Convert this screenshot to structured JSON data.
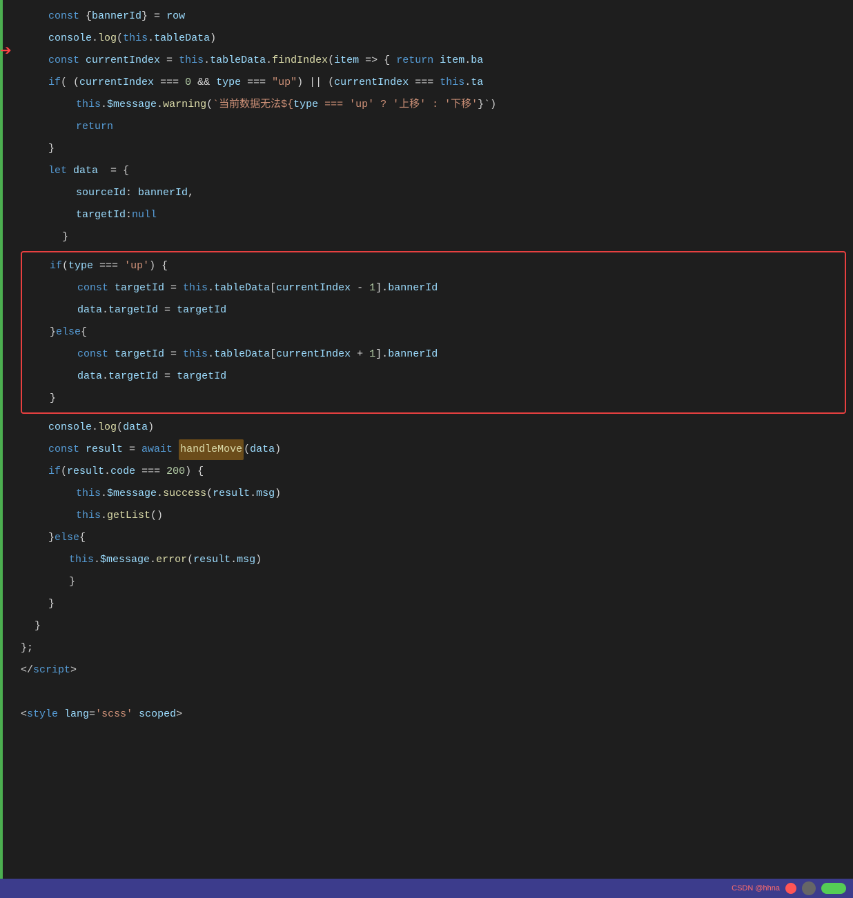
{
  "code": {
    "lines": [
      {
        "id": "line1",
        "indent": 2,
        "tokens": [
          {
            "type": "kw",
            "text": "const "
          },
          {
            "type": "punc",
            "text": "{"
          },
          {
            "type": "var",
            "text": "bannerId"
          },
          {
            "type": "punc",
            "text": "} = "
          },
          {
            "type": "var",
            "text": "row"
          }
        ]
      },
      {
        "id": "line2",
        "indent": 2,
        "tokens": [
          {
            "type": "var",
            "text": "console"
          },
          {
            "type": "punc",
            "text": "."
          },
          {
            "type": "fn",
            "text": "log"
          },
          {
            "type": "punc",
            "text": "("
          },
          {
            "type": "this-kw",
            "text": "this"
          },
          {
            "type": "punc",
            "text": "."
          },
          {
            "type": "var",
            "text": "tableData"
          },
          {
            "type": "punc",
            "text": ")"
          }
        ]
      },
      {
        "id": "line3",
        "indent": 2,
        "tokens": [
          {
            "type": "kw",
            "text": "const "
          },
          {
            "type": "var",
            "text": "currentIndex"
          },
          {
            "type": "punc",
            "text": " = "
          },
          {
            "type": "this-kw",
            "text": "this"
          },
          {
            "type": "punc",
            "text": "."
          },
          {
            "type": "var",
            "text": "tableData"
          },
          {
            "type": "punc",
            "text": "."
          },
          {
            "type": "fn",
            "text": "findIndex"
          },
          {
            "type": "punc",
            "text": "("
          },
          {
            "type": "var",
            "text": "item"
          },
          {
            "type": "punc",
            "text": " => { "
          },
          {
            "type": "kw",
            "text": "return "
          },
          {
            "type": "var",
            "text": "item"
          },
          {
            "type": "punc",
            "text": "."
          },
          {
            "type": "prop",
            "text": "ba"
          }
        ]
      },
      {
        "id": "line4",
        "indent": 2,
        "tokens": [
          {
            "type": "kw",
            "text": "if"
          },
          {
            "type": "punc",
            "text": "( ("
          },
          {
            "type": "var",
            "text": "currentIndex"
          },
          {
            "type": "punc",
            "text": " === "
          },
          {
            "type": "num",
            "text": "0"
          },
          {
            "type": "punc",
            "text": " && "
          },
          {
            "type": "var",
            "text": "type"
          },
          {
            "type": "punc",
            "text": " === "
          },
          {
            "type": "str",
            "text": "\"up\""
          },
          {
            "type": "punc",
            "text": ") || ("
          },
          {
            "type": "var",
            "text": "currentIndex"
          },
          {
            "type": "punc",
            "text": " === "
          },
          {
            "type": "this-kw",
            "text": "this"
          },
          {
            "type": "punc",
            "text": "."
          },
          {
            "type": "prop",
            "text": "ta"
          }
        ]
      },
      {
        "id": "line5",
        "indent": 4,
        "tokens": [
          {
            "type": "this-kw",
            "text": "this"
          },
          {
            "type": "punc",
            "text": "."
          },
          {
            "type": "prop",
            "text": "$message"
          },
          {
            "type": "punc",
            "text": "."
          },
          {
            "type": "fn",
            "text": "warning"
          },
          {
            "type": "punc",
            "text": "("
          },
          {
            "type": "template",
            "text": "`当前数据无法${"
          },
          {
            "type": "var",
            "text": "type"
          },
          {
            "type": "template",
            "text": " === 'up' ? '上移' : '下移'"
          },
          {
            "type": "punc",
            "text": "}`"
          }
        ]
      },
      {
        "id": "line6",
        "indent": 4,
        "tokens": [
          {
            "type": "kw",
            "text": "return"
          }
        ]
      },
      {
        "id": "line7",
        "indent": 2,
        "tokens": [
          {
            "type": "punc",
            "text": "}"
          }
        ]
      },
      {
        "id": "line8",
        "indent": 2,
        "tokens": [
          {
            "type": "kw",
            "text": "let "
          },
          {
            "type": "var",
            "text": "data"
          },
          {
            "type": "punc",
            "text": "  = {"
          }
        ]
      },
      {
        "id": "line9",
        "indent": 4,
        "tokens": [
          {
            "type": "prop",
            "text": "sourceId"
          },
          {
            "type": "punc",
            "text": ": "
          },
          {
            "type": "var",
            "text": "bannerId"
          },
          {
            "type": "punc",
            "text": ","
          }
        ]
      },
      {
        "id": "line10",
        "indent": 4,
        "tokens": [
          {
            "type": "prop",
            "text": "targetId"
          },
          {
            "type": "punc",
            "text": ":"
          },
          {
            "type": "kw",
            "text": "null"
          }
        ]
      },
      {
        "id": "line11",
        "indent": 2,
        "tokens": [
          {
            "type": "punc",
            "text": "  }"
          }
        ]
      },
      {
        "id": "highlighted_start",
        "is_box_start": true
      },
      {
        "id": "hline1",
        "indent": 2,
        "tokens": [
          {
            "type": "kw",
            "text": "if"
          },
          {
            "type": "punc",
            "text": "("
          },
          {
            "type": "var",
            "text": "type"
          },
          {
            "type": "punc",
            "text": " === "
          },
          {
            "type": "str",
            "text": "'up'"
          },
          {
            "type": "punc",
            "text": ") {"
          }
        ]
      },
      {
        "id": "hline2",
        "indent": 4,
        "tokens": [
          {
            "type": "kw",
            "text": "const "
          },
          {
            "type": "var",
            "text": "targetId"
          },
          {
            "type": "punc",
            "text": " = "
          },
          {
            "type": "this-kw",
            "text": "this"
          },
          {
            "type": "punc",
            "text": "."
          },
          {
            "type": "var",
            "text": "tableData"
          },
          {
            "type": "punc",
            "text": "["
          },
          {
            "type": "var",
            "text": "currentIndex"
          },
          {
            "type": "punc",
            "text": " - "
          },
          {
            "type": "num",
            "text": "1"
          },
          {
            "type": "punc",
            "text": "]."
          },
          {
            "type": "prop",
            "text": "bannerId"
          }
        ]
      },
      {
        "id": "hline3",
        "indent": 4,
        "tokens": [
          {
            "type": "var",
            "text": "data"
          },
          {
            "type": "punc",
            "text": "."
          },
          {
            "type": "prop",
            "text": "targetId"
          },
          {
            "type": "punc",
            "text": " = "
          },
          {
            "type": "var",
            "text": "targetId"
          }
        ]
      },
      {
        "id": "hline4",
        "indent": 2,
        "tokens": [
          {
            "type": "punc",
            "text": "}"
          },
          {
            "type": "kw",
            "text": "else"
          },
          {
            "type": "punc",
            "text": "{"
          }
        ]
      },
      {
        "id": "hline5",
        "indent": 4,
        "tokens": [
          {
            "type": "kw",
            "text": "const "
          },
          {
            "type": "var",
            "text": "targetId"
          },
          {
            "type": "punc",
            "text": " = "
          },
          {
            "type": "this-kw",
            "text": "this"
          },
          {
            "type": "punc",
            "text": "."
          },
          {
            "type": "var",
            "text": "tableData"
          },
          {
            "type": "punc",
            "text": "["
          },
          {
            "type": "var",
            "text": "currentIndex"
          },
          {
            "type": "punc",
            "text": " + "
          },
          {
            "type": "num",
            "text": "1"
          },
          {
            "type": "punc",
            "text": "]."
          },
          {
            "type": "prop",
            "text": "bannerId"
          }
        ]
      },
      {
        "id": "hline6",
        "indent": 4,
        "tokens": [
          {
            "type": "var",
            "text": "data"
          },
          {
            "type": "punc",
            "text": "."
          },
          {
            "type": "prop",
            "text": "targetId"
          },
          {
            "type": "punc",
            "text": " = "
          },
          {
            "type": "var",
            "text": "targetId"
          }
        ]
      },
      {
        "id": "hline7",
        "indent": 2,
        "tokens": [
          {
            "type": "punc",
            "text": "}"
          }
        ]
      },
      {
        "id": "highlighted_end",
        "is_box_end": true
      },
      {
        "id": "line12",
        "indent": 2,
        "tokens": [
          {
            "type": "var",
            "text": "console"
          },
          {
            "type": "punc",
            "text": "."
          },
          {
            "type": "fn",
            "text": "log"
          },
          {
            "type": "punc",
            "text": "("
          },
          {
            "type": "var",
            "text": "data"
          },
          {
            "type": "punc",
            "text": ")"
          }
        ]
      },
      {
        "id": "line13",
        "indent": 2,
        "tokens": [
          {
            "type": "kw",
            "text": "const "
          },
          {
            "type": "var",
            "text": "result"
          },
          {
            "type": "punc",
            "text": " = "
          },
          {
            "type": "kw",
            "text": "await "
          },
          {
            "type": "fn-highlight",
            "text": "handleMove"
          },
          {
            "type": "punc",
            "text": "("
          },
          {
            "type": "var",
            "text": "data"
          },
          {
            "type": "punc",
            "text": ")"
          }
        ]
      },
      {
        "id": "line14",
        "indent": 2,
        "tokens": [
          {
            "type": "kw",
            "text": "if"
          },
          {
            "type": "punc",
            "text": "("
          },
          {
            "type": "var",
            "text": "result"
          },
          {
            "type": "punc",
            "text": "."
          },
          {
            "type": "prop",
            "text": "code"
          },
          {
            "type": "punc",
            "text": " === "
          },
          {
            "type": "num",
            "text": "200"
          },
          {
            "type": "punc",
            "text": ") {"
          }
        ]
      },
      {
        "id": "line15",
        "indent": 4,
        "tokens": [
          {
            "type": "this-kw",
            "text": "this"
          },
          {
            "type": "punc",
            "text": "."
          },
          {
            "type": "prop",
            "text": "$message"
          },
          {
            "type": "punc",
            "text": "."
          },
          {
            "type": "fn",
            "text": "success"
          },
          {
            "type": "punc",
            "text": "("
          },
          {
            "type": "var",
            "text": "result"
          },
          {
            "type": "punc",
            "text": "."
          },
          {
            "type": "prop",
            "text": "msg"
          },
          {
            "type": "punc",
            "text": ")"
          }
        ]
      },
      {
        "id": "line16",
        "indent": 4,
        "tokens": [
          {
            "type": "this-kw",
            "text": "this"
          },
          {
            "type": "punc",
            "text": "."
          },
          {
            "type": "fn",
            "text": "getList"
          },
          {
            "type": "punc",
            "text": "()"
          }
        ]
      },
      {
        "id": "line17",
        "indent": 2,
        "tokens": [
          {
            "type": "punc",
            "text": "}"
          },
          {
            "type": "kw",
            "text": "else"
          },
          {
            "type": "punc",
            "text": "{"
          }
        ]
      },
      {
        "id": "line18",
        "indent": 4,
        "tokens": [
          {
            "type": "this-kw",
            "text": "this"
          },
          {
            "type": "punc",
            "text": "."
          },
          {
            "type": "prop",
            "text": "$message"
          },
          {
            "type": "punc",
            "text": "."
          },
          {
            "type": "fn",
            "text": "error"
          },
          {
            "type": "punc",
            "text": "("
          },
          {
            "type": "var",
            "text": "result"
          },
          {
            "type": "punc",
            "text": "."
          },
          {
            "type": "prop",
            "text": "msg"
          },
          {
            "type": "punc",
            "text": ")"
          }
        ]
      },
      {
        "id": "line19",
        "indent": 4,
        "tokens": [
          {
            "type": "punc",
            "text": "}"
          }
        ]
      },
      {
        "id": "line20",
        "indent": 2,
        "tokens": [
          {
            "type": "punc",
            "text": "}"
          }
        ]
      },
      {
        "id": "line21",
        "indent": 1,
        "tokens": [
          {
            "type": "punc",
            "text": "}"
          }
        ]
      },
      {
        "id": "line22",
        "indent": 0,
        "tokens": [
          {
            "type": "punc",
            "text": "};"
          }
        ]
      },
      {
        "id": "line23",
        "indent": 0,
        "tokens": [
          {
            "type": "punc",
            "text": "</"
          },
          {
            "type": "kw",
            "text": "script"
          },
          {
            "type": "punc",
            "text": ">"
          }
        ]
      },
      {
        "id": "line24",
        "indent": 0,
        "tokens": []
      },
      {
        "id": "line25",
        "indent": 0,
        "tokens": [
          {
            "type": "punc",
            "text": "<"
          },
          {
            "type": "kw",
            "text": "style "
          },
          {
            "type": "prop",
            "text": "lang"
          },
          {
            "type": "punc",
            "text": "="
          },
          {
            "type": "str",
            "text": "'scss'"
          },
          {
            "type": "punc",
            "text": " "
          },
          {
            "type": "prop",
            "text": "scoped"
          },
          {
            "type": "punc",
            "text": ">"
          }
        ]
      }
    ]
  },
  "bottom_bar": {
    "csdn_text": "CSDN @hhna",
    "icons": [
      "dot-red",
      "dot-green",
      "avatar"
    ]
  }
}
